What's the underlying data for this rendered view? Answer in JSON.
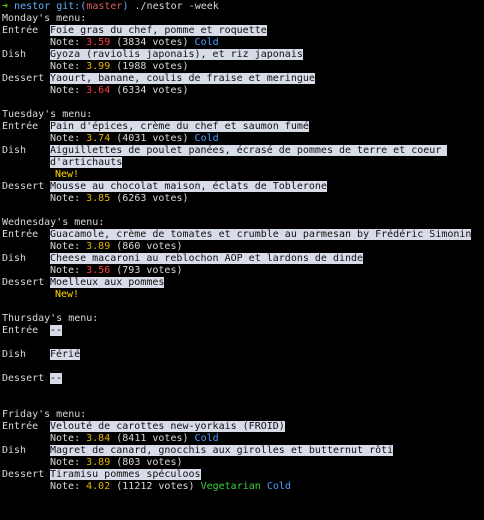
{
  "prompt": {
    "arrow": "➜",
    "repo": "nestor",
    "git_prefix": "git:(",
    "branch": "master",
    "git_suffix": ")",
    "command": "./nestor -week"
  },
  "days": [
    {
      "title": "Monday's menu:",
      "courses": [
        {
          "label": "Entrée",
          "dish": "Foie gras du chef, pomme et roquette",
          "note_prefix": "Note:",
          "score": "3.59",
          "votes": "(3834 votes)",
          "tags": [
            "Cold"
          ],
          "new": ""
        },
        {
          "label": "Dish",
          "dish": "Gyoza (raviolis japonais), et riz japonais",
          "note_prefix": "Note:",
          "score": "3.99",
          "votes": "(1988 votes)",
          "tags": [],
          "new": ""
        },
        {
          "label": "Dessert",
          "dish": "Yaourt, banane, coulis de fraise et meringue",
          "note_prefix": "Note:",
          "score": "3.64",
          "votes": "(6334 votes)",
          "tags": [],
          "new": ""
        }
      ]
    },
    {
      "title": "Tuesday's menu:",
      "courses": [
        {
          "label": "Entrée",
          "dish": "Pain d'épices, crème du chef et saumon fumé",
          "note_prefix": "Note:",
          "score": "3.74",
          "votes": "(4031 votes)",
          "tags": [
            "Cold"
          ],
          "new": ""
        },
        {
          "label": "Dish",
          "dish": "Aiguillettes de poulet panées, écrasé de pommes de terre et coeur d'artichauts",
          "note_prefix": "",
          "score": "",
          "votes": "",
          "tags": [],
          "new": "New!"
        },
        {
          "label": "Dessert",
          "dish": "Mousse au chocolat maison, éclats de Toblerone",
          "note_prefix": "Note:",
          "score": "3.85",
          "votes": "(6263 votes)",
          "tags": [],
          "new": ""
        }
      ]
    },
    {
      "title": "Wednesday's menu:",
      "courses": [
        {
          "label": "Entrée",
          "dish": "Guacamole, crème de tomates et crumble au parmesan by Frédéric Simonin",
          "note_prefix": "Note:",
          "score": "3.89",
          "votes": "(860 votes)",
          "tags": [],
          "new": ""
        },
        {
          "label": "Dish",
          "dish": "Cheese macaroni au reblochon AOP et lardons de dinde",
          "note_prefix": "Note:",
          "score": "3.56",
          "votes": "(793 votes)",
          "tags": [],
          "new": ""
        },
        {
          "label": "Dessert",
          "dish": "Moelleux aux pommes",
          "note_prefix": "",
          "score": "",
          "votes": "",
          "tags": [],
          "new": "New!"
        }
      ]
    },
    {
      "title": "Thursday's menu:",
      "courses": [
        {
          "label": "Entrée",
          "dish": "--",
          "note_prefix": "",
          "score": "",
          "votes": "",
          "tags": [],
          "new": ""
        },
        {
          "label": "Dish",
          "dish": "Férié",
          "note_prefix": "",
          "score": "",
          "votes": "",
          "tags": [],
          "new": ""
        },
        {
          "label": "Dessert",
          "dish": "--",
          "note_prefix": "",
          "score": "",
          "votes": "",
          "tags": [],
          "new": ""
        }
      ]
    },
    {
      "title": "Friday's menu:",
      "courses": [
        {
          "label": "Entrée",
          "dish": "Velouté de carottes new-yorkais (FROID)",
          "note_prefix": "Note:",
          "score": "3.84",
          "votes": "(8411 votes)",
          "tags": [
            "Cold"
          ],
          "new": ""
        },
        {
          "label": "Dish",
          "dish": "Magret de canard, gnocchis aux girolles et butternut rôti",
          "note_prefix": "Note:",
          "score": "3.89",
          "votes": "(803 votes)",
          "tags": [],
          "new": ""
        },
        {
          "label": "Dessert",
          "dish": "Tiramisu pommes spéculoos",
          "note_prefix": "Note:",
          "score": "4.02",
          "votes": "(11212 votes)",
          "tags": [
            "Vegetarian",
            "Cold"
          ],
          "new": ""
        }
      ]
    }
  ],
  "colors": {
    "score_low": "#ff3c3c",
    "score_high": "#e8b400",
    "cold": "#4f9cff",
    "vegetarian": "#3ccf3c",
    "new": "#ffd700",
    "highlight": "#d8dce8"
  }
}
